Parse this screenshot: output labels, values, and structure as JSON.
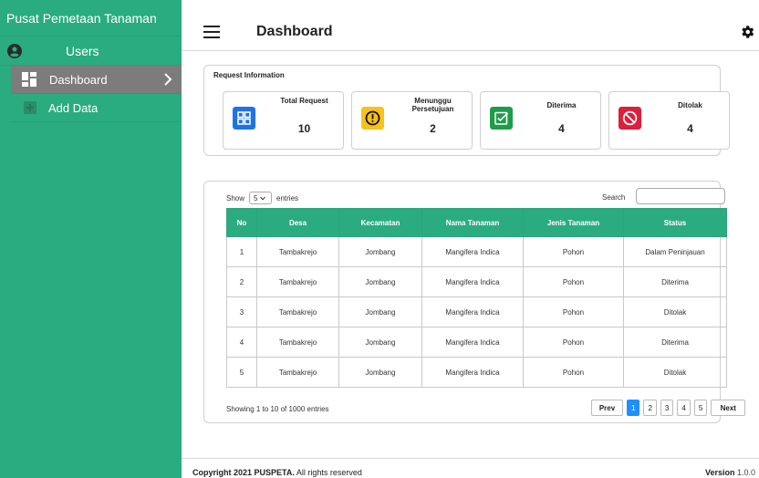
{
  "app": {
    "brand": "Pusat Pemetaan Tanaman"
  },
  "sidebar": {
    "user_label": "Users",
    "items": [
      {
        "label": "Dashboard",
        "icon": "dashboard-icon",
        "active": true
      },
      {
        "label": "Add Data",
        "icon": "add-box-icon",
        "active": false
      }
    ]
  },
  "header": {
    "title": "Dashboard",
    "settings_icon": "gear-icon",
    "menu_icon": "hamburger-icon"
  },
  "request_info": {
    "title": "Request Information",
    "stats": [
      {
        "label": "Total Request",
        "value": "10",
        "color": "#1e73e8",
        "icon": "grid-icon"
      },
      {
        "label": "Menunggu Persetujuan",
        "value": "2",
        "color": "#f7c21b",
        "icon": "alert-circle-icon"
      },
      {
        "label": "Diterima",
        "value": "4",
        "color": "#1e9c4a",
        "icon": "check-square-icon"
      },
      {
        "label": "Ditolak",
        "value": "4",
        "color": "#dc1f3a",
        "icon": "block-icon"
      }
    ]
  },
  "table": {
    "show_label": "Show",
    "entries_value": "5",
    "entries_label": "entries",
    "search_label": "Search",
    "search_placeholder": "",
    "columns": [
      "No",
      "Desa",
      "Kecamatan",
      "Nama Tanaman",
      "Jenis Tanaman",
      "Status"
    ],
    "rows": [
      [
        "1",
        "Tambakrejo",
        "Jombang",
        "Mangifera Indica",
        "Pohon",
        "Dalam Peninjauan"
      ],
      [
        "2",
        "Tambakrejo",
        "Jombang",
        "Mangifera Indica",
        "Pohon",
        "Diterima"
      ],
      [
        "3",
        "Tambakrejo",
        "Jombang",
        "Mangifera Indica",
        "Pohon",
        "Ditolak"
      ],
      [
        "4",
        "Tambakrejo",
        "Jombang",
        "Mangifera Indica",
        "Pohon",
        "Diterima"
      ],
      [
        "5",
        "Tambakrejo",
        "Jombang",
        "Mangifera Indica",
        "Pohon",
        "Ditolak"
      ]
    ],
    "showing_text": "Showing 1 to 10 of 1000 entries",
    "pagination": {
      "prev": "Prev",
      "pages": [
        "1",
        "2",
        "3",
        "4",
        "5"
      ],
      "active": "1",
      "next": "Next"
    }
  },
  "footer": {
    "copyright_prefix": "Copyright 2021 PUSPETA.",
    "copyright_suffix": "All rights reserved",
    "version_label": "Version",
    "version_value": "1.0.0"
  }
}
